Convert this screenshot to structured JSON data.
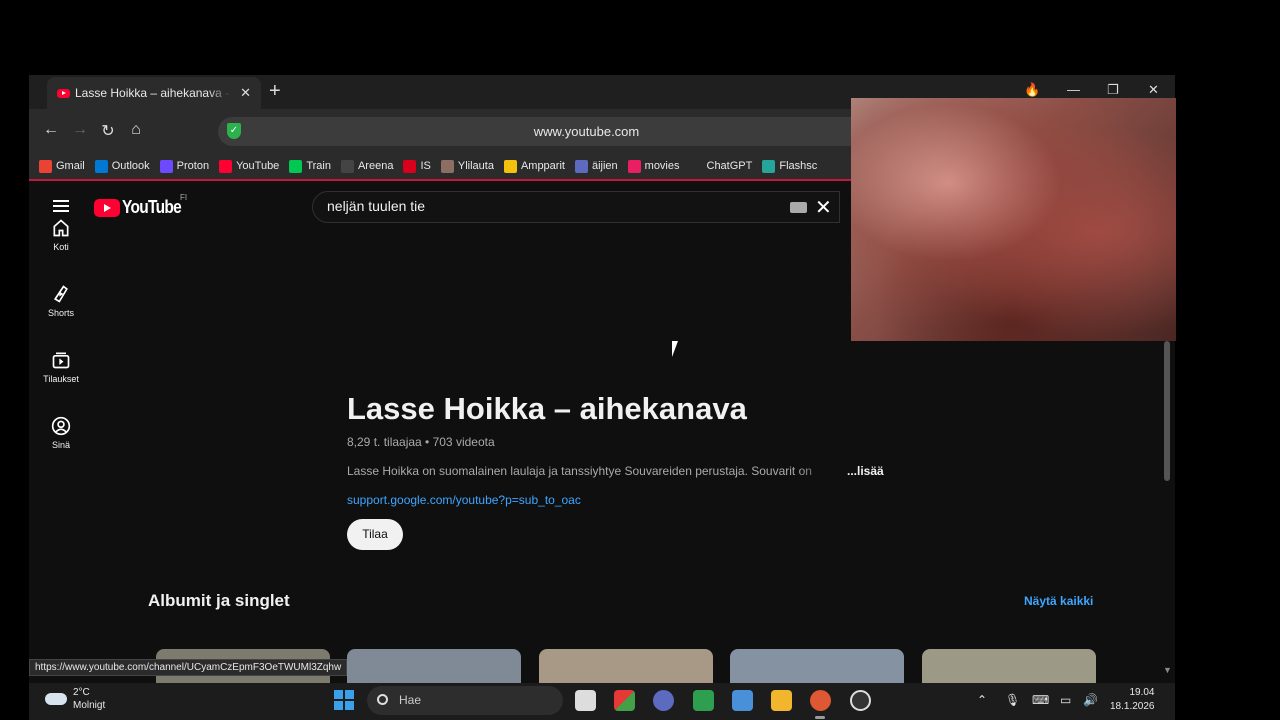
{
  "browser": {
    "tab_title": "Lasse Hoikka – aihekanava - YouTube",
    "url": "www.youtube.com",
    "bookmarks": [
      {
        "label": "Gmail",
        "icon": "gmail-icon",
        "color": "#ea4335"
      },
      {
        "label": "Outlook",
        "icon": "outlook-icon",
        "color": "#0078d4"
      },
      {
        "label": "Proton",
        "icon": "proton-icon",
        "color": "#6d4aff"
      },
      {
        "label": "YouTube",
        "icon": "youtube-icon",
        "color": "#ff0033"
      },
      {
        "label": "Train",
        "icon": "train-icon",
        "color": "#00c853"
      },
      {
        "label": "Areena",
        "icon": "areena-icon",
        "color": "#444444"
      },
      {
        "label": "IS",
        "icon": "is-icon",
        "color": "#d9001b"
      },
      {
        "label": "Ylilauta",
        "icon": "ylilauta-icon",
        "color": "#8d6e63"
      },
      {
        "label": "Ampparit",
        "icon": "ampparit-icon",
        "color": "#f4c20d"
      },
      {
        "label": "äijien",
        "icon": "aijien-icon",
        "color": "#5c6bc0"
      },
      {
        "label": "movies",
        "icon": "heart-icon",
        "color": "#e91e63"
      },
      {
        "label": "ChatGPT",
        "icon": "bookmark-icon",
        "color": "#2b2b2b"
      },
      {
        "label": "Flashsc",
        "icon": "flashscore-icon",
        "color": "#26a69a"
      }
    ],
    "status_url": "https://www.youtube.com/channel/UCyamCzEpmF3OeTWUMl3Zqhw"
  },
  "youtube": {
    "logo_text": "YouTube",
    "logo_country": "FI",
    "search_value": "neljän tuulen tie",
    "sidebar": [
      {
        "label": "Koti",
        "icon": "home-icon"
      },
      {
        "label": "Shorts",
        "icon": "shorts-icon"
      },
      {
        "label": "Tilaukset",
        "icon": "subscriptions-icon"
      },
      {
        "label": "Sinä",
        "icon": "you-icon"
      }
    ],
    "channel": {
      "title": "Lasse Hoikka – aihekanava",
      "meta": "8,29 t. tilaajaa • 703 videota",
      "description": "Lasse Hoikka on suomalainen laulaja ja tanssiyhtye Souvareiden perustaja. Souvarit on",
      "more": "...lisää",
      "link": "support.google.com/youtube?p=sub_to_oac",
      "subscribe": "Tilaa"
    },
    "section": {
      "title": "Albumit ja singlet",
      "see_all": "Näytä kaikki",
      "thumb_colors": [
        "#7d7a6e",
        "#7f8a96",
        "#a89886",
        "#8592a2",
        "#9c9a86"
      ]
    }
  },
  "taskbar": {
    "weather_temp": "2°C",
    "weather_desc": "Molnigt",
    "search_placeholder": "Hae",
    "time": "19.04",
    "date": "18.1.2026"
  }
}
